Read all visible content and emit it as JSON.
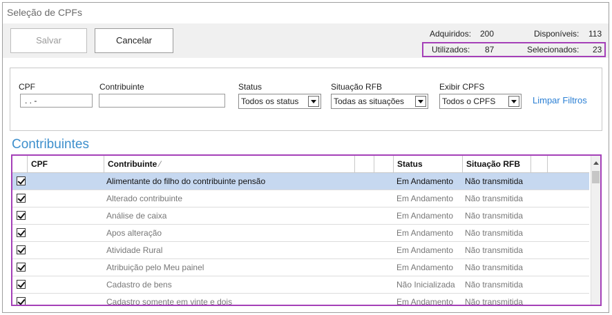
{
  "window": {
    "title": "Seleção de CPFs"
  },
  "toolbar": {
    "save_label": "Salvar",
    "cancel_label": "Cancelar"
  },
  "stats": {
    "adquiridos_label": "Adquiridos:",
    "adquiridos_value": "200",
    "disponiveis_label": "Disponíveis:",
    "disponiveis_value": "113",
    "utilizados_label": "Utilizados:",
    "utilizados_value": "87",
    "selecionados_label": "Selecionados:",
    "selecionados_value": "23"
  },
  "filters": {
    "cpf_label": "CPF",
    "cpf_value": ".    .    -",
    "contribuinte_label": "Contribuinte",
    "contribuinte_value": "",
    "status_label": "Status",
    "status_value": "Todos os status",
    "situacao_label": "Situação RFB",
    "situacao_value": "Todas as situações",
    "exibir_label": "Exibir CPFS",
    "exibir_value": "Todos o CPFS",
    "clear_label": "Limpar Filtros"
  },
  "section_title": "Contribuintes",
  "table": {
    "headers": {
      "cpf": "CPF",
      "contribuinte": "Contribuinte",
      "sort_indicator": "⁄",
      "status": "Status",
      "situacao": "Situação RFB"
    },
    "rows": [
      {
        "contribuinte": "Alimentante do filho do contribuinte pensão",
        "status": "Em Andamento",
        "situacao": "Não transmitida",
        "checked": true,
        "selected": true
      },
      {
        "contribuinte": "Alterado contribuinte",
        "status": "Em Andamento",
        "situacao": "Não transmitida",
        "checked": true,
        "selected": false
      },
      {
        "contribuinte": "Análise de caixa",
        "status": "Em Andamento",
        "situacao": "Não transmitida",
        "checked": true,
        "selected": false
      },
      {
        "contribuinte": "Apos alteração",
        "status": "Em Andamento",
        "situacao": "Não transmitida",
        "checked": true,
        "selected": false
      },
      {
        "contribuinte": "Atividade Rural",
        "status": "Em Andamento",
        "situacao": "Não transmitida",
        "checked": true,
        "selected": false
      },
      {
        "contribuinte": "Atribuição pelo Meu painel",
        "status": "Em Andamento",
        "situacao": "Não transmitida",
        "checked": true,
        "selected": false
      },
      {
        "contribuinte": "Cadastro de bens",
        "status": "Não Inicializada",
        "situacao": "Não transmitida",
        "checked": true,
        "selected": false
      },
      {
        "contribuinte": "Cadastro somente em vinte e dois",
        "status": "Em Andamento",
        "situacao": "Não transmitida",
        "checked": true,
        "selected": false
      }
    ]
  },
  "colors": {
    "highlight": "#a43fb8",
    "accent": "#3d8fcc",
    "selected_row": "#c6d8f0",
    "link": "#2a7fd4"
  }
}
